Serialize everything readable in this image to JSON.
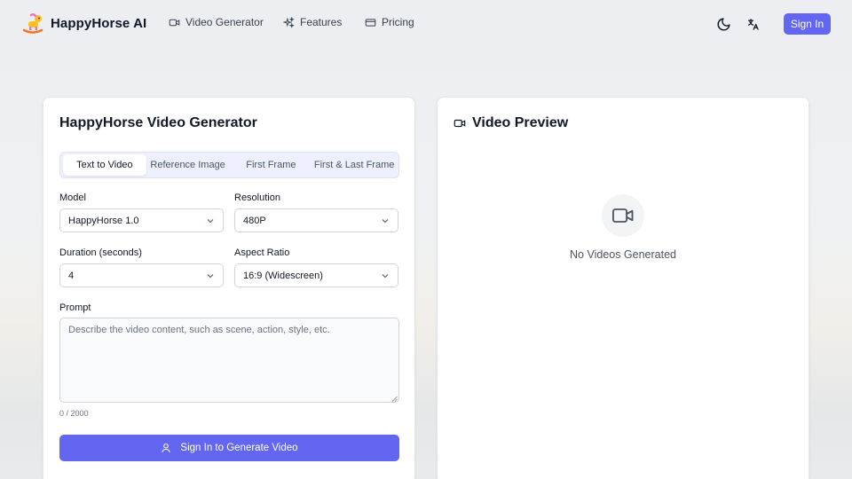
{
  "header": {
    "brand": "HappyHorse AI",
    "nav": [
      {
        "label": "Video Generator",
        "icon": "video-icon"
      },
      {
        "label": "Features",
        "icon": "sparkles-icon"
      },
      {
        "label": "Pricing",
        "icon": "credit-card-icon"
      }
    ],
    "theme_icon": "moon-icon",
    "language_icon": "translate-icon",
    "sign_in_label": "Sign In"
  },
  "generator": {
    "title": "HappyHorse Video Generator",
    "tabs": [
      {
        "label": "Text to Video",
        "active": true
      },
      {
        "label": "Reference Image",
        "active": false
      },
      {
        "label": "First Frame",
        "active": false
      },
      {
        "label": "First & Last Frame",
        "active": false
      }
    ],
    "model": {
      "label": "Model",
      "value": "HappyHorse 1.0"
    },
    "resolution": {
      "label": "Resolution",
      "value": "480P"
    },
    "duration": {
      "label": "Duration (seconds)",
      "value": "4"
    },
    "aspect_ratio": {
      "label": "Aspect Ratio",
      "value": "16:9 (Widescreen)"
    },
    "prompt": {
      "label": "Prompt",
      "placeholder": "Describe the video content, such as scene, action, style, etc.",
      "counter": "0 / 2000"
    },
    "generate_label": "Sign In to Generate Video"
  },
  "preview": {
    "title": "Video Preview",
    "empty_text": "No Videos Generated"
  },
  "colors": {
    "accent": "#6366f1",
    "tab_bg": "#eef0ff"
  }
}
